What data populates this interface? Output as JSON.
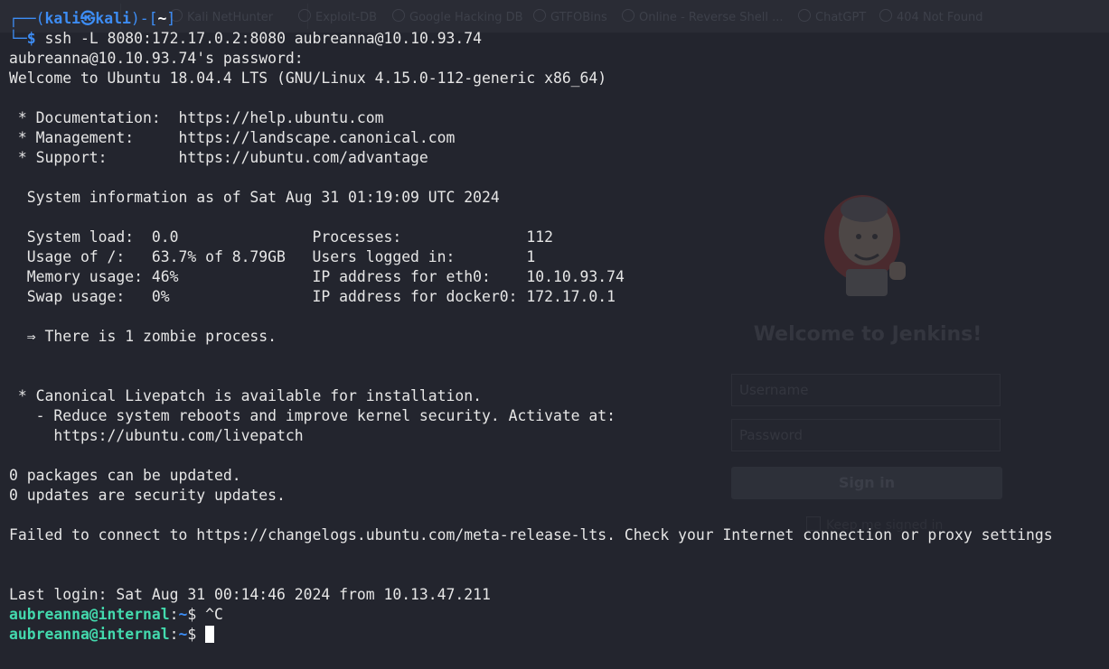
{
  "browser_bg": {
    "bookmarks": [
      {
        "label": "Kali NetHunter"
      },
      {
        "label": "Exploit-DB"
      },
      {
        "label": "Google Hacking DB"
      },
      {
        "label": "GTFOBins"
      },
      {
        "label": "Online - Reverse Shell ..."
      },
      {
        "label": "ChatGPT"
      },
      {
        "label": "404 Not Found"
      }
    ],
    "jenkins": {
      "title": "Welcome to Jenkins!",
      "username_placeholder": "Username",
      "password_placeholder": "Password",
      "signin_label": "Sign in",
      "remember_label": "Keep me signed in"
    }
  },
  "terminal": {
    "prompt_header": {
      "prefix": "┌──(",
      "user": "kali",
      "at": "㉿",
      "host": "kali",
      "mid": ")-[",
      "dir": "~",
      "suffix": "]"
    },
    "prompt_line": {
      "prefix": "└─",
      "symbol": "$ ",
      "command": "ssh -L 8080:172.17.0.2:8080 aubreanna@10.10.93.74"
    },
    "output": [
      "aubreanna@10.10.93.74's password:",
      "Welcome to Ubuntu 18.04.4 LTS (GNU/Linux 4.15.0-112-generic x86_64)",
      "",
      " * Documentation:  https://help.ubuntu.com",
      " * Management:     https://landscape.canonical.com",
      " * Support:        https://ubuntu.com/advantage",
      "",
      "  System information as of Sat Aug 31 01:19:09 UTC 2024",
      "",
      "  System load:  0.0               Processes:              112",
      "  Usage of /:   63.7% of 8.79GB   Users logged in:        1",
      "  Memory usage: 46%               IP address for eth0:    10.10.93.74",
      "  Swap usage:   0%                IP address for docker0: 172.17.0.1",
      "",
      "  ⇒ There is 1 zombie process.",
      "",
      "",
      " * Canonical Livepatch is available for installation.",
      "   - Reduce system reboots and improve kernel security. Activate at:",
      "     https://ubuntu.com/livepatch",
      "",
      "0 packages can be updated.",
      "0 updates are security updates.",
      "",
      "Failed to connect to https://changelogs.ubuntu.com/meta-release-lts. Check your Internet connection or proxy settings",
      "",
      "",
      "Last login: Sat Aug 31 00:14:46 2024 from 10.13.47.211"
    ],
    "remote_prompts": [
      {
        "user_host": "aubreanna@internal",
        "sep": ":",
        "path": "~",
        "symbol": "$ ",
        "input": "^C"
      },
      {
        "user_host": "aubreanna@internal",
        "sep": ":",
        "path": "~",
        "symbol": "$ ",
        "input": ""
      }
    ],
    "colors": {
      "background": "#23252e",
      "foreground": "#e6e6e6",
      "kali_blue": "#3d8df5",
      "remote_prompt_green": "#43d9ad"
    }
  }
}
